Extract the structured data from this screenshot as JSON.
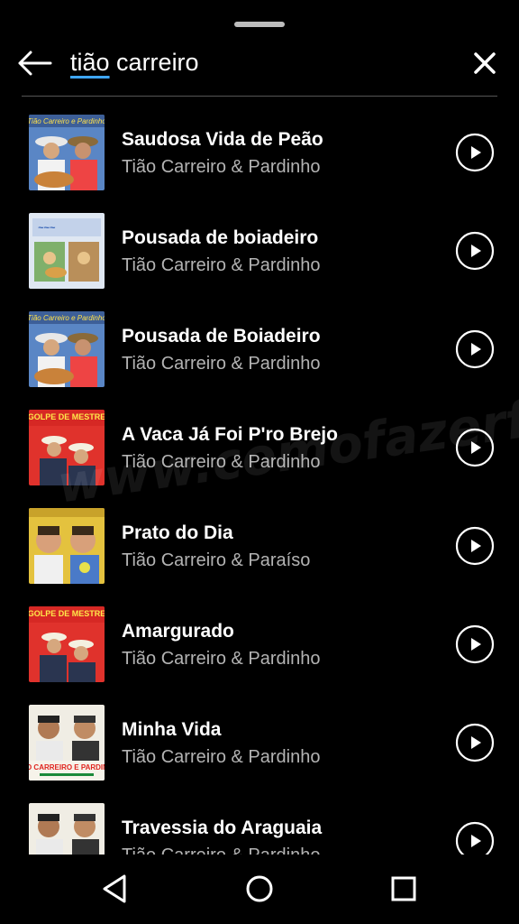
{
  "search": {
    "query_part1": "tião",
    "query_part2": " carreiro"
  },
  "results": [
    {
      "title": "Saudosa Vida de Peão",
      "artist": "Tião Carreiro & Pardinho",
      "cover_text": "Tião Carreiro e Pardinho"
    },
    {
      "title": "Pousada de boiadeiro",
      "artist": "Tião Carreiro & Pardinho",
      "cover_text": ""
    },
    {
      "title": "Pousada de Boiadeiro",
      "artist": "Tião Carreiro & Pardinho",
      "cover_text": "Tião Carreiro e Pardinho"
    },
    {
      "title": "A Vaca Já Foi P'ro Brejo",
      "artist": "Tião Carreiro & Pardinho",
      "cover_text": "GOLPE DE MESTRE"
    },
    {
      "title": "Prato do Dia",
      "artist": "Tião Carreiro & Paraíso",
      "cover_text": ""
    },
    {
      "title": "Amargurado",
      "artist": "Tião Carreiro & Pardinho",
      "cover_text": "GOLPE DE MESTRE"
    },
    {
      "title": "Minha Vida",
      "artist": "Tião Carreiro & Pardinho",
      "cover_text": "TIÃO CARREIRO E PARDINHO"
    },
    {
      "title": "Travessia do Araguaia",
      "artist": "Tião Carreiro & Pardinho",
      "cover_text": ""
    }
  ],
  "watermark": "www.comofazerfacil.com.br",
  "icons": {
    "back": "arrow-left-icon",
    "close": "close-icon",
    "play": "play-circle-icon",
    "nav_back": "triangle-back-icon",
    "nav_home": "circle-home-icon",
    "nav_recents": "square-recents-icon"
  },
  "colors": {
    "background": "#000000",
    "accent_underline": "#3ea6ff",
    "secondary_text": "#b3b3b3"
  }
}
